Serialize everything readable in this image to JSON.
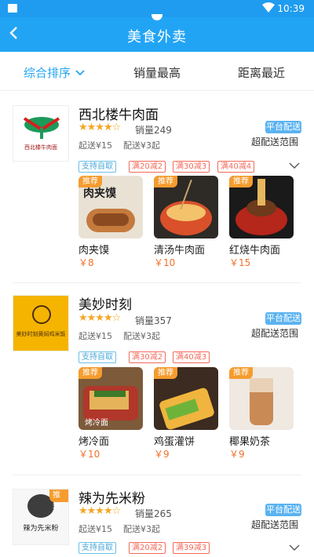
{
  "status": {
    "time": "10:39"
  },
  "header": {
    "back_icon": "chevron-left-icon",
    "title": "美食外卖"
  },
  "sort": {
    "option1": "综合排序",
    "option2": "销量最高",
    "option3": "距离最近"
  },
  "shops": [
    {
      "name": "西北楼牛肉面",
      "logo_text": "西北楼牛肉面",
      "rating_stars": "★★★★☆",
      "sales": "销量249",
      "min_fee": "起送¥15",
      "delivery_fee": "配送¥3起",
      "platform_badge": "平台配送",
      "range": "超配送范围",
      "tags": [
        "支持自取",
        "满20减2",
        "满30减3",
        "满40减4"
      ],
      "foods": [
        {
          "badge": "推荐",
          "name": "肉夹馍",
          "price": "￥8",
          "img_text": "肉夹馍"
        },
        {
          "badge": "推荐",
          "name": "清汤牛肉面",
          "price": "￥10"
        },
        {
          "badge": "推荐",
          "name": "红烧牛肉面",
          "price": "￥15"
        }
      ]
    },
    {
      "name": "美妙时刻",
      "logo_text": "美妙时刻黄焖鸡米饭",
      "rating_stars": "★★★★☆",
      "sales": "销量357",
      "min_fee": "起送¥15",
      "delivery_fee": "配送¥3起",
      "platform_badge": "平台配送",
      "range": "超配送范围",
      "tags": [
        "支持自取",
        "满30减2",
        "满40减3"
      ],
      "foods": [
        {
          "badge": "推荐",
          "name": "烤冷面",
          "price": "￥10",
          "img_text": "烤冷面"
        },
        {
          "badge": "推荐",
          "name": "鸡蛋灌饼",
          "price": "￥9"
        },
        {
          "badge": "推荐",
          "name": "椰果奶茶",
          "price": "￥9"
        }
      ]
    },
    {
      "name": "辣为先米粉",
      "logo_text": "辣为先米粉",
      "logo_badge": "推荐",
      "rating_stars": "★★★★☆",
      "sales": "销量265",
      "min_fee": "起送¥15",
      "delivery_fee": "配送¥3起",
      "platform_badge": "平台配送",
      "range": "超配送范围",
      "tags": [
        "支持自取",
        "满20减2",
        "满39减3"
      ]
    }
  ]
}
